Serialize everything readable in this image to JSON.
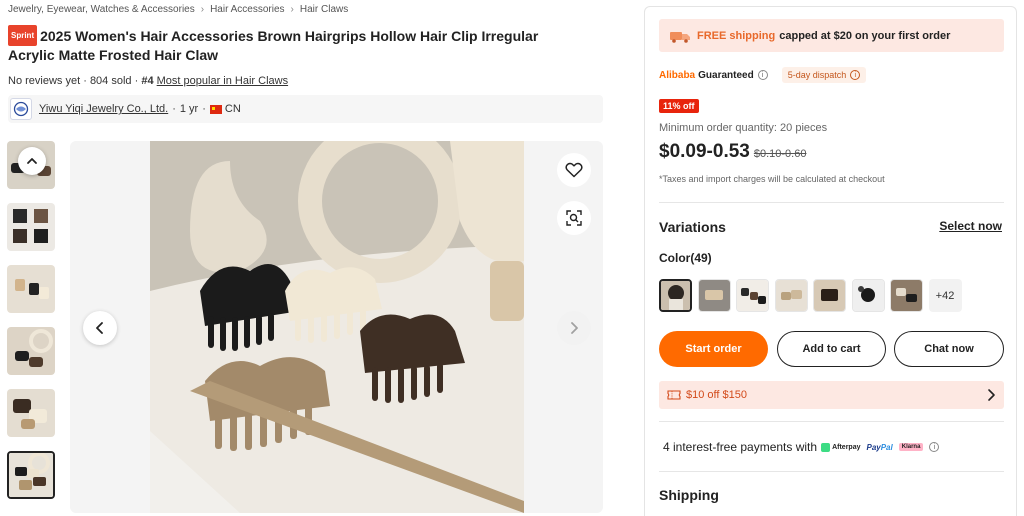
{
  "breadcrumb": {
    "items": [
      "Jewelry, Eyewear, Watches & Accessories",
      "Hair Accessories",
      "Hair Claws"
    ],
    "separator": "›"
  },
  "product": {
    "badge": "Sprint",
    "title": "2025 Women's Hair Accessories Brown Hairgrips Hollow Hair Clip Irregular Acrylic Matte Frosted Hair Claw",
    "reviews": "No reviews yet",
    "dot": "·",
    "sold": "804 sold",
    "rank": "#4",
    "rank_link": "Most popular in Hair Claws"
  },
  "supplier": {
    "name": "Yiwu Yiqi Jewelry Co., Ltd.",
    "years": "1 yr",
    "country": "CN"
  },
  "gallery": {
    "thumb_count": 6,
    "active_index": 5
  },
  "panel": {
    "shipping_banner": {
      "accent_text": "FREE shipping",
      "rest_text": "capped at $20 on your first order"
    },
    "guarantee": {
      "brand": "Alibaba",
      "word": "Guaranteed",
      "dispatch": "5-day dispatch"
    },
    "discount_badge": "11% off",
    "moq": "Minimum order quantity: 20 pieces",
    "price": "$0.09-0.53",
    "price_old": "$0.10-0.60",
    "tax_note": "*Taxes and import charges will be calculated at checkout",
    "variations_title": "Variations",
    "select_now": "Select now",
    "color_label": "Color(49)",
    "swatch_more": "+42",
    "buttons": {
      "start_order": "Start order",
      "add_to_cart": "Add to cart",
      "chat_now": "Chat now"
    },
    "coupon": "$10 off $150",
    "payments": {
      "text": "4 interest-free payments with",
      "afterpay": "Afterpay",
      "paypal_a": "Pay",
      "paypal_b": "Pal",
      "klarna": "Klarna"
    },
    "shipping_title": "Shipping"
  },
  "colors": {
    "accent": "#ff6a00",
    "banner_bg": "#fde8e2",
    "discount": "#e8240c"
  }
}
